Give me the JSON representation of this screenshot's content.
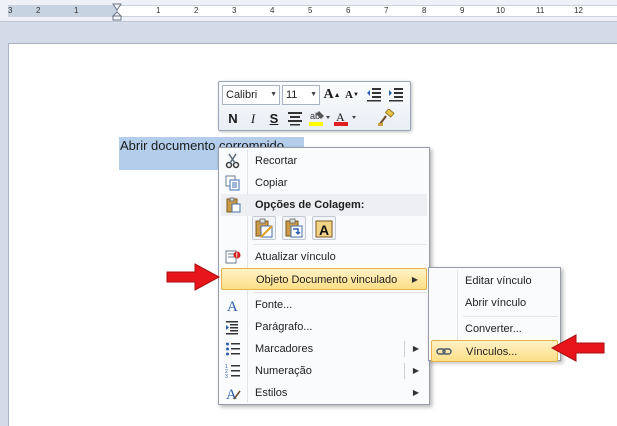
{
  "ruler": {
    "numbers": [
      "3",
      "1",
      "2",
      "1",
      "1",
      "2",
      "3",
      "4",
      "5",
      "6",
      "7",
      "8",
      "9",
      "10",
      "11",
      "12"
    ]
  },
  "document": {
    "selected_text": "Abrir documento corrompido"
  },
  "mini_toolbar": {
    "font_name": "Calibri",
    "font_size": "11",
    "grow_font": "A",
    "shrink_font": "A",
    "bold": "N",
    "italic": "I",
    "underline": "S",
    "highlight_color": "#ffff00",
    "font_color": "#e02020",
    "font_color_letter": "A",
    "highlight_letters": "ab"
  },
  "context_menu": {
    "items": [
      {
        "label": "Recortar",
        "icon": "scissors-icon"
      },
      {
        "label": "Copiar",
        "icon": "copy-icon"
      },
      {
        "label": "Opções de Colagem:",
        "icon": "paste-icon"
      },
      {
        "label": "Atualizar vínculo",
        "icon": "update-link-icon"
      },
      {
        "label": "Objeto Documento vinculado",
        "icon": ""
      },
      {
        "label": "Fonte...",
        "icon": "font-icon"
      },
      {
        "label": "Parágrafo...",
        "icon": "paragraph-icon"
      },
      {
        "label": "Marcadores",
        "icon": "bullets-icon"
      },
      {
        "label": "Numeração",
        "icon": "numbering-icon"
      },
      {
        "label": "Estilos",
        "icon": "styles-icon"
      }
    ],
    "paste_keep_text_letter": "A"
  },
  "submenu": {
    "items": [
      {
        "label": "Editar  vínculo"
      },
      {
        "label": "Abrir  vínculo"
      },
      {
        "label": "Converter..."
      },
      {
        "label": "Vínculos...",
        "icon": "chain-link-icon"
      }
    ]
  },
  "colors": {
    "selection": "#b3cdea",
    "highlight_bg": "#fddf86",
    "highlight_border": "#e6b44a",
    "arrow_red": "#e8151b"
  }
}
